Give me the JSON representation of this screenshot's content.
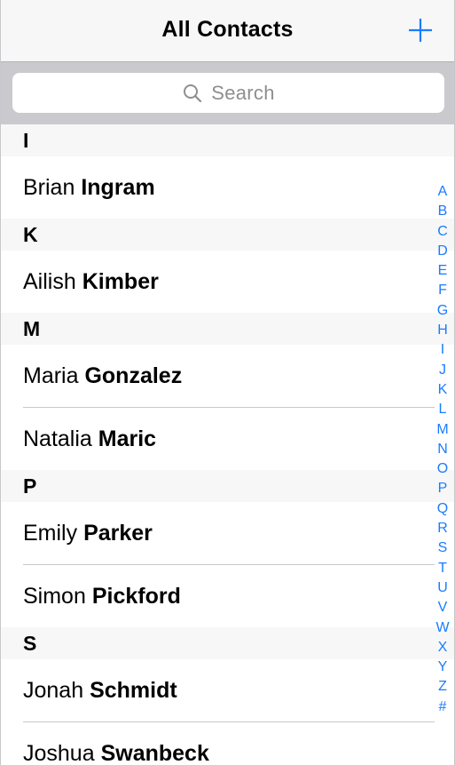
{
  "navbar": {
    "title": "All Contacts",
    "add_icon": "plus-icon",
    "tint": "#1a7cff"
  },
  "search": {
    "placeholder": "Search",
    "icon": "search-icon"
  },
  "sections": [
    {
      "letter": "I",
      "contacts": [
        {
          "first": "Brian",
          "last": "Ingram"
        }
      ]
    },
    {
      "letter": "K",
      "contacts": [
        {
          "first": "Ailish",
          "last": "Kimber"
        }
      ]
    },
    {
      "letter": "M",
      "contacts": [
        {
          "first": "Maria",
          "last": "Gonzalez"
        },
        {
          "first": "Natalia",
          "last": "Maric"
        }
      ]
    },
    {
      "letter": "P",
      "contacts": [
        {
          "first": "Emily",
          "last": "Parker"
        },
        {
          "first": "Simon",
          "last": "Pickford"
        }
      ]
    },
    {
      "letter": "S",
      "contacts": [
        {
          "first": "Jonah",
          "last": "Schmidt"
        },
        {
          "first": "Joshua",
          "last": "Swanbeck"
        }
      ]
    }
  ],
  "index": [
    "A",
    "B",
    "C",
    "D",
    "E",
    "F",
    "G",
    "H",
    "I",
    "J",
    "K",
    "L",
    "M",
    "N",
    "O",
    "P",
    "Q",
    "R",
    "S",
    "T",
    "U",
    "V",
    "W",
    "X",
    "Y",
    "Z",
    "#"
  ]
}
